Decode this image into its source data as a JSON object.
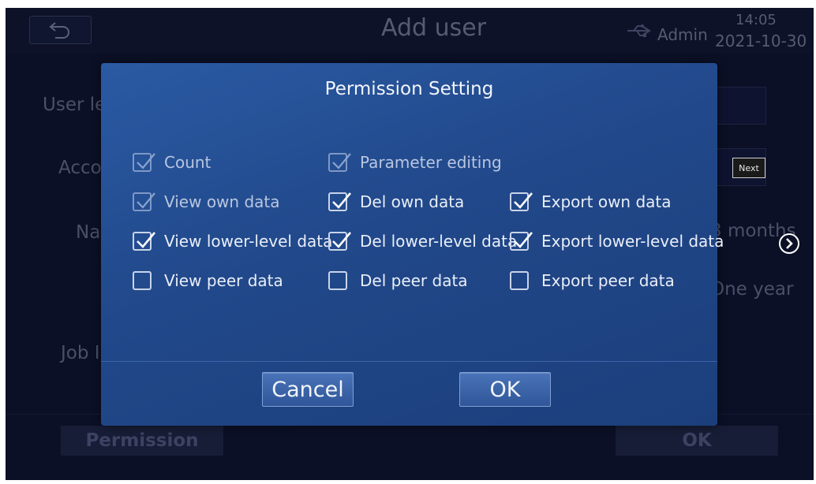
{
  "header": {
    "title": "Add user",
    "user": "Admin",
    "time": "14:05",
    "date": "2021-10-30"
  },
  "background": {
    "labels": {
      "user_level": "User le",
      "account": "Acco",
      "name": "Na",
      "job": "Job I"
    },
    "next_tag": "Next",
    "validity_options": [
      "3 months",
      "One year"
    ],
    "permission_button": "Permission",
    "ok_button": "OK"
  },
  "dialog": {
    "title": "Permission Setting",
    "permissions": [
      {
        "label": "Count",
        "checked": true,
        "locked": true
      },
      {
        "label": "Parameter editing",
        "checked": true,
        "locked": true
      },
      {
        "label": "View own data",
        "checked": true,
        "locked": true
      },
      {
        "label": "Del own data",
        "checked": true,
        "locked": false
      },
      {
        "label": "Export own data",
        "checked": true,
        "locked": false
      },
      {
        "label": "View lower-level data",
        "checked": true,
        "locked": false
      },
      {
        "label": "Del lower-level data",
        "checked": true,
        "locked": false
      },
      {
        "label": "Export lower-level data",
        "checked": true,
        "locked": false
      },
      {
        "label": "View peer data",
        "checked": false,
        "locked": false
      },
      {
        "label": "Del peer data",
        "checked": false,
        "locked": false
      },
      {
        "label": "Export peer data",
        "checked": false,
        "locked": false
      }
    ],
    "cancel_label": "Cancel",
    "ok_label": "OK"
  },
  "colors": {
    "dialog_bg": "#21488a",
    "button_bg": "#3a64a8",
    "screen_bg": "#0b1026"
  }
}
